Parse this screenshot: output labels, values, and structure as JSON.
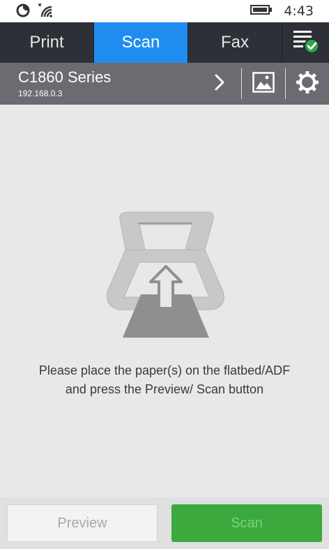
{
  "status_bar": {
    "time": "4:43",
    "icons": [
      "nfc-icon",
      "wifi-icon",
      "battery-icon"
    ]
  },
  "tabs": [
    {
      "label": "Print",
      "active": false
    },
    {
      "label": "Scan",
      "active": true
    },
    {
      "label": "Fax",
      "active": false
    }
  ],
  "device": {
    "name": "C1860 Series",
    "ip": "192.168.0.3"
  },
  "main": {
    "instruction": "Please place the paper(s) on the flatbed/ADF and press the Preview/ Scan button"
  },
  "buttons": {
    "preview_label": "Preview",
    "scan_label": "Scan"
  },
  "colors": {
    "tab_active": "#1f8df0",
    "tab_bar": "#2d3037",
    "device_bar": "#6a6c72",
    "scan_button": "#3ca93e",
    "check_green": "#2ea44f"
  }
}
